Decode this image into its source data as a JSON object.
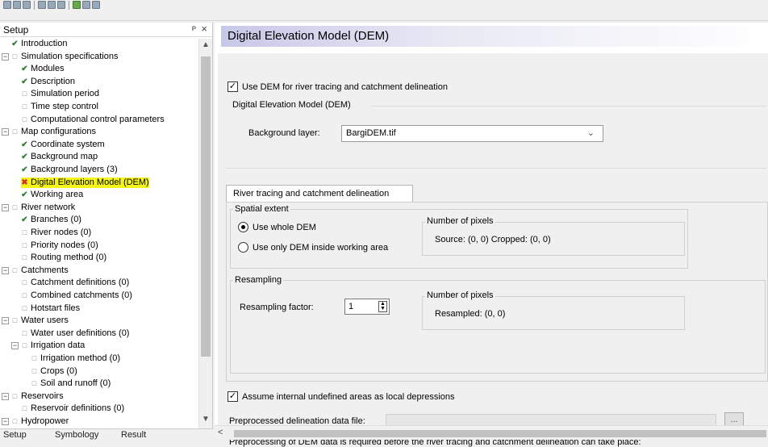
{
  "left_panel": {
    "title": "Setup",
    "pin_glyph": "ᴘ",
    "close_glyph": "×",
    "tree": [
      {
        "label": "Introduction",
        "status": "check",
        "level": 0
      },
      {
        "label": "Simulation specifications",
        "status": "box",
        "level": 0,
        "expander": "−"
      },
      {
        "label": "Modules",
        "status": "check",
        "level": 1
      },
      {
        "label": "Description",
        "status": "check",
        "level": 1
      },
      {
        "label": "Simulation period",
        "status": "box",
        "level": 1
      },
      {
        "label": "Time step control",
        "status": "box",
        "level": 1
      },
      {
        "label": "Computational control parameters",
        "status": "box",
        "level": 1
      },
      {
        "label": "Map configurations",
        "status": "box",
        "level": 0,
        "expander": "−"
      },
      {
        "label": "Coordinate system",
        "status": "check",
        "level": 1
      },
      {
        "label": "Background map",
        "status": "check",
        "level": 1
      },
      {
        "label": "Background layers (3)",
        "status": "check",
        "level": 1
      },
      {
        "label": "Digital Elevation Model (DEM)",
        "status": "cross",
        "level": 1,
        "highlight": true
      },
      {
        "label": "Working area",
        "status": "check",
        "level": 1
      },
      {
        "label": "River network",
        "status": "box",
        "level": 0,
        "expander": "−"
      },
      {
        "label": "Branches (0)",
        "status": "check",
        "level": 1
      },
      {
        "label": "River nodes (0)",
        "status": "box",
        "level": 1
      },
      {
        "label": "Priority nodes (0)",
        "status": "box",
        "level": 1
      },
      {
        "label": "Routing method (0)",
        "status": "box",
        "level": 1
      },
      {
        "label": "Catchments",
        "status": "box",
        "level": 0,
        "expander": "−"
      },
      {
        "label": "Catchment definitions (0)",
        "status": "box",
        "level": 1
      },
      {
        "label": "Combined catchments (0)",
        "status": "box",
        "level": 1
      },
      {
        "label": "Hotstart files",
        "status": "box",
        "level": 1
      },
      {
        "label": "Water users",
        "status": "box",
        "level": 0,
        "expander": "−"
      },
      {
        "label": "Water user definitions (0)",
        "status": "box",
        "level": 1
      },
      {
        "label": "Irrigation data",
        "status": "box",
        "level": 1,
        "expander": "−"
      },
      {
        "label": "Irrigation method (0)",
        "status": "box",
        "level": 2
      },
      {
        "label": "Crops (0)",
        "status": "box",
        "level": 2
      },
      {
        "label": "Soil and runoff (0)",
        "status": "box",
        "level": 2
      },
      {
        "label": "Reservoirs",
        "status": "box",
        "level": 0,
        "expander": "−"
      },
      {
        "label": "Reservoir definitions (0)",
        "status": "box",
        "level": 1
      },
      {
        "label": "Hydropower",
        "status": "box",
        "level": 0,
        "expander": "−"
      }
    ],
    "bottom_tabs": [
      "Setup",
      "Symbology",
      "Result"
    ]
  },
  "main": {
    "title": "Digital Elevation Model (DEM)",
    "use_dem_checkbox_label": "Use DEM for river tracing and catchment delineation",
    "use_dem_checked": true,
    "dem_group_label": "Digital Elevation Model (DEM)",
    "background_layer_label": "Background layer:",
    "background_layer_value": "BargiDEM.tif",
    "tab_label": "River tracing and catchment delineation",
    "spatial_extent_label": "Spatial extent",
    "radio_whole": "Use whole DEM",
    "radio_inside": "Use only DEM inside working area",
    "number_of_pixels_label": "Number of pixels",
    "pixels_source_text": "Source: (0, 0)  Cropped: (0, 0)",
    "resampling_label": "Resampling",
    "resampling_factor_label": "Resampling factor:",
    "resampling_factor_value": "1",
    "number_of_pixels_label_2": "Number of pixels",
    "pixels_resampled_text": "Resampled: (0, 0)",
    "assume_checkbox_label": "Assume internal undefined areas as local depressions",
    "assume_checked": true,
    "preprocessed_file_label": "Preprocessed delineation data file:",
    "browse_label": "...",
    "note_text": "Preprocessing of DEM data is required before the river tracing and catchment delineation can take place:"
  }
}
